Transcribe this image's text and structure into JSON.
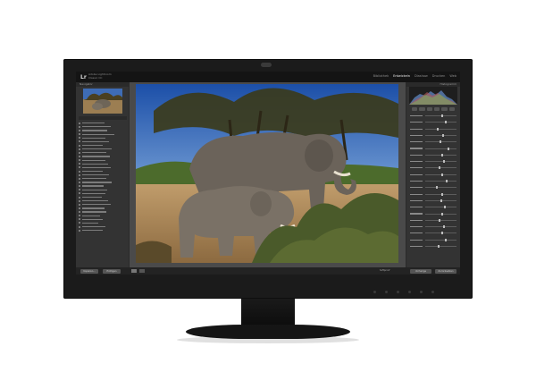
{
  "app": {
    "badge": "Lr",
    "title_line1": "Adobe Lightroom",
    "title_line2": "Classic CC"
  },
  "modules": [
    {
      "label": "Bibliothek",
      "active": false
    },
    {
      "label": "Entwickeln",
      "active": true
    },
    {
      "label": "Diashow",
      "active": false
    },
    {
      "label": "Drucken",
      "active": false
    },
    {
      "label": "Web",
      "active": false
    }
  ],
  "left_panel": {
    "navigator_label": "Navigator",
    "folder_bar_widths_pct": [
      55,
      70,
      62,
      80,
      58,
      66,
      52,
      74,
      61,
      69,
      57,
      64,
      71,
      50,
      66,
      60,
      73,
      54,
      62,
      58,
      48,
      64,
      70,
      55,
      60,
      45,
      52,
      40,
      58,
      50
    ],
    "bottom_buttons": [
      "Kopieren...",
      "Einfügen"
    ]
  },
  "right_panel": {
    "histogram_label": "Histogramm",
    "slider_knob_pct": [
      50,
      62,
      38,
      55,
      45,
      70,
      50,
      58,
      42,
      50,
      66,
      35,
      52,
      48,
      60,
      50,
      44,
      56,
      50,
      63,
      40
    ],
    "bottom_buttons": [
      "Vorherige",
      "Zurücksetzen"
    ]
  },
  "toolbar": {
    "soft_proof_label": "Softproof"
  },
  "colors": {
    "screen_bg": "#2a2a2a",
    "panel_bg": "#333333",
    "active_module": "#f0f0f0",
    "filmstrip_highlight": "#6ea6d8"
  }
}
